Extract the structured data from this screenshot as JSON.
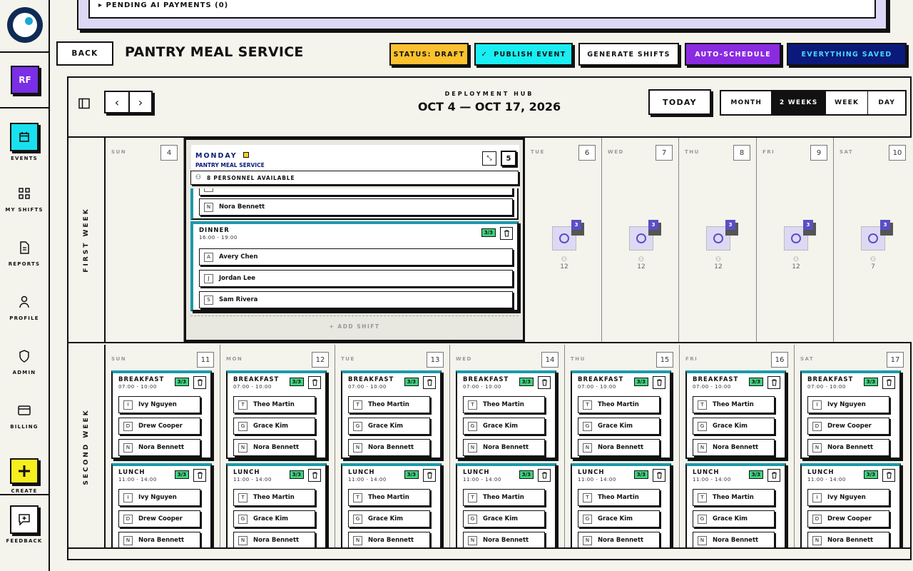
{
  "pending": {
    "label": "▸ PENDING AI PAYMENTS (0)"
  },
  "sidebar": {
    "avatar": "RF",
    "items": [
      {
        "label": "EVENTS",
        "icon": "calendar-icon"
      },
      {
        "label": "MY SHIFTS",
        "icon": "grid-icon"
      },
      {
        "label": "REPORTS",
        "icon": "document-icon"
      },
      {
        "label": "PROFILE",
        "icon": "user-icon"
      },
      {
        "label": "ADMIN",
        "icon": "shield-icon"
      },
      {
        "label": "BILLING",
        "icon": "card-icon"
      },
      {
        "label": "CREATE",
        "icon": "plus-icon"
      },
      {
        "label": "FEEDBACK",
        "icon": "feedback-icon"
      }
    ]
  },
  "toolbar": {
    "back": "BACK",
    "title": "PANTRY MEAL SERVICE",
    "status": "STATUS: DRAFT",
    "publish": "PUBLISH EVENT",
    "generate": "GENERATE SHIFTS",
    "auto": "AUTO-SCHEDULE",
    "saved": "EVERYTHING SAVED"
  },
  "colors": {
    "status": "#fbc12f",
    "publish": "#19eef2",
    "auto": "#8a2be2",
    "saved": "#0b1a7a",
    "accent": "#1b9aaa",
    "count": "#3fd27f"
  },
  "calendar": {
    "kicker": "DEPLOYMENT HUB",
    "range": "OCT 4 — OCT 17, 2026",
    "today": "TODAY",
    "views": [
      "MONTH",
      "2 WEEKS",
      "WEEK",
      "DAY"
    ],
    "active_view": "2 WEEKS",
    "week1_label": "FIRST WEEK",
    "week2_label": "SECOND WEEK",
    "week1": [
      {
        "name": "SUN",
        "num": "4"
      },
      {
        "name": "MON",
        "num": "5"
      },
      {
        "name": "TUE",
        "num": "6",
        "shifts": "3",
        "people": "12"
      },
      {
        "name": "WED",
        "num": "7",
        "shifts": "3",
        "people": "12"
      },
      {
        "name": "THU",
        "num": "8",
        "shifts": "3",
        "people": "12"
      },
      {
        "name": "FRI",
        "num": "9",
        "shifts": "3",
        "people": "12"
      },
      {
        "name": "SAT",
        "num": "10",
        "shifts": "3",
        "people": "7"
      }
    ],
    "expanded": {
      "day": "MONDAY",
      "event": "PANTRY MEAL SERVICE",
      "num": "5",
      "personnel": "8 PERSONNEL AVAILABLE",
      "partial_name": "Nora Bennett",
      "partial_initial": "N",
      "dinner": {
        "name": "DINNER",
        "time": "16:00 - 19:00",
        "count": "3/3",
        "people": [
          {
            "initial": "A",
            "name": "Avery Chen"
          },
          {
            "initial": "J",
            "name": "Jordan Lee"
          },
          {
            "initial": "S",
            "name": "Sam Rivera"
          }
        ]
      },
      "add_shift": "+ ADD SHIFT"
    },
    "week2": [
      {
        "name": "SUN",
        "num": "11",
        "crew": [
          [
            "I",
            "Ivy Nguyen"
          ],
          [
            "D",
            "Drew Cooper"
          ],
          [
            "N",
            "Nora Bennett"
          ]
        ]
      },
      {
        "name": "MON",
        "num": "12",
        "crew": [
          [
            "T",
            "Theo Martin"
          ],
          [
            "G",
            "Grace Kim"
          ],
          [
            "N",
            "Nora Bennett"
          ]
        ]
      },
      {
        "name": "TUE",
        "num": "13",
        "crew": [
          [
            "T",
            "Theo Martin"
          ],
          [
            "G",
            "Grace Kim"
          ],
          [
            "N",
            "Nora Bennett"
          ]
        ]
      },
      {
        "name": "WED",
        "num": "14",
        "crew": [
          [
            "T",
            "Theo Martin"
          ],
          [
            "G",
            "Grace Kim"
          ],
          [
            "N",
            "Nora Bennett"
          ]
        ]
      },
      {
        "name": "THU",
        "num": "15",
        "crew": [
          [
            "T",
            "Theo Martin"
          ],
          [
            "G",
            "Grace Kim"
          ],
          [
            "N",
            "Nora Bennett"
          ]
        ]
      },
      {
        "name": "FRI",
        "num": "16",
        "crew": [
          [
            "T",
            "Theo Martin"
          ],
          [
            "G",
            "Grace Kim"
          ],
          [
            "N",
            "Nora Bennett"
          ]
        ]
      },
      {
        "name": "SAT",
        "num": "17",
        "crew": [
          [
            "I",
            "Ivy Nguyen"
          ],
          [
            "D",
            "Drew Cooper"
          ],
          [
            "N",
            "Nora Bennett"
          ]
        ]
      }
    ],
    "breakfast": {
      "name": "BREAKFAST",
      "time": "07:00 - 10:00",
      "count": "3/3"
    },
    "lunch": {
      "name": "LUNCH",
      "time": "11:00 - 14:00",
      "count": "3/3"
    }
  }
}
